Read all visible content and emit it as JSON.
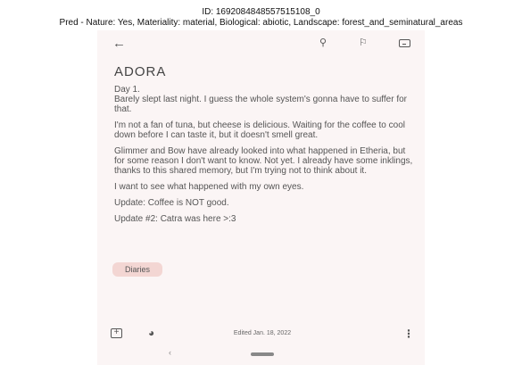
{
  "caption": {
    "id_line": "ID: 1692084848557515108_0",
    "pred_line": "Pred - Nature: Yes, Materiality: material, Biological: abiotic, Landscape: forest_and_seminatural_areas"
  },
  "note": {
    "title": "ADORA",
    "paragraphs": [
      "Day 1.\nBarely slept last night. I guess the whole system's gonna have to suffer for that.",
      "I'm not a fan of tuna, but cheese is delicious. Waiting for the coffee to cool down before I can taste it, but it doesn't smell great.",
      "Glimmer and Bow have already looked into what happened in Etheria, but for some reason I don't want to know. Not yet. I already have some inklings, thanks to this shared memory, but I'm trying not to think about it.",
      "I want to see what happened with my own eyes.",
      "Update: Coffee is NOT good.",
      "Update #2: Catra was here >:3"
    ],
    "label": "Diaries"
  },
  "toolbar": {
    "back_icon": "arrow-left-icon",
    "pin_icon": "pin-icon",
    "reminder_icon": "bell-plus-icon",
    "archive_icon": "archive-icon"
  },
  "bottom": {
    "edited": "Edited Jan. 18, 2022",
    "add_icon": "add-box-icon",
    "palette_icon": "palette-icon",
    "more_icon": "more-vert-icon"
  },
  "colors": {
    "background": "#fbf5f5",
    "label_chip": "#f3d6d3"
  }
}
